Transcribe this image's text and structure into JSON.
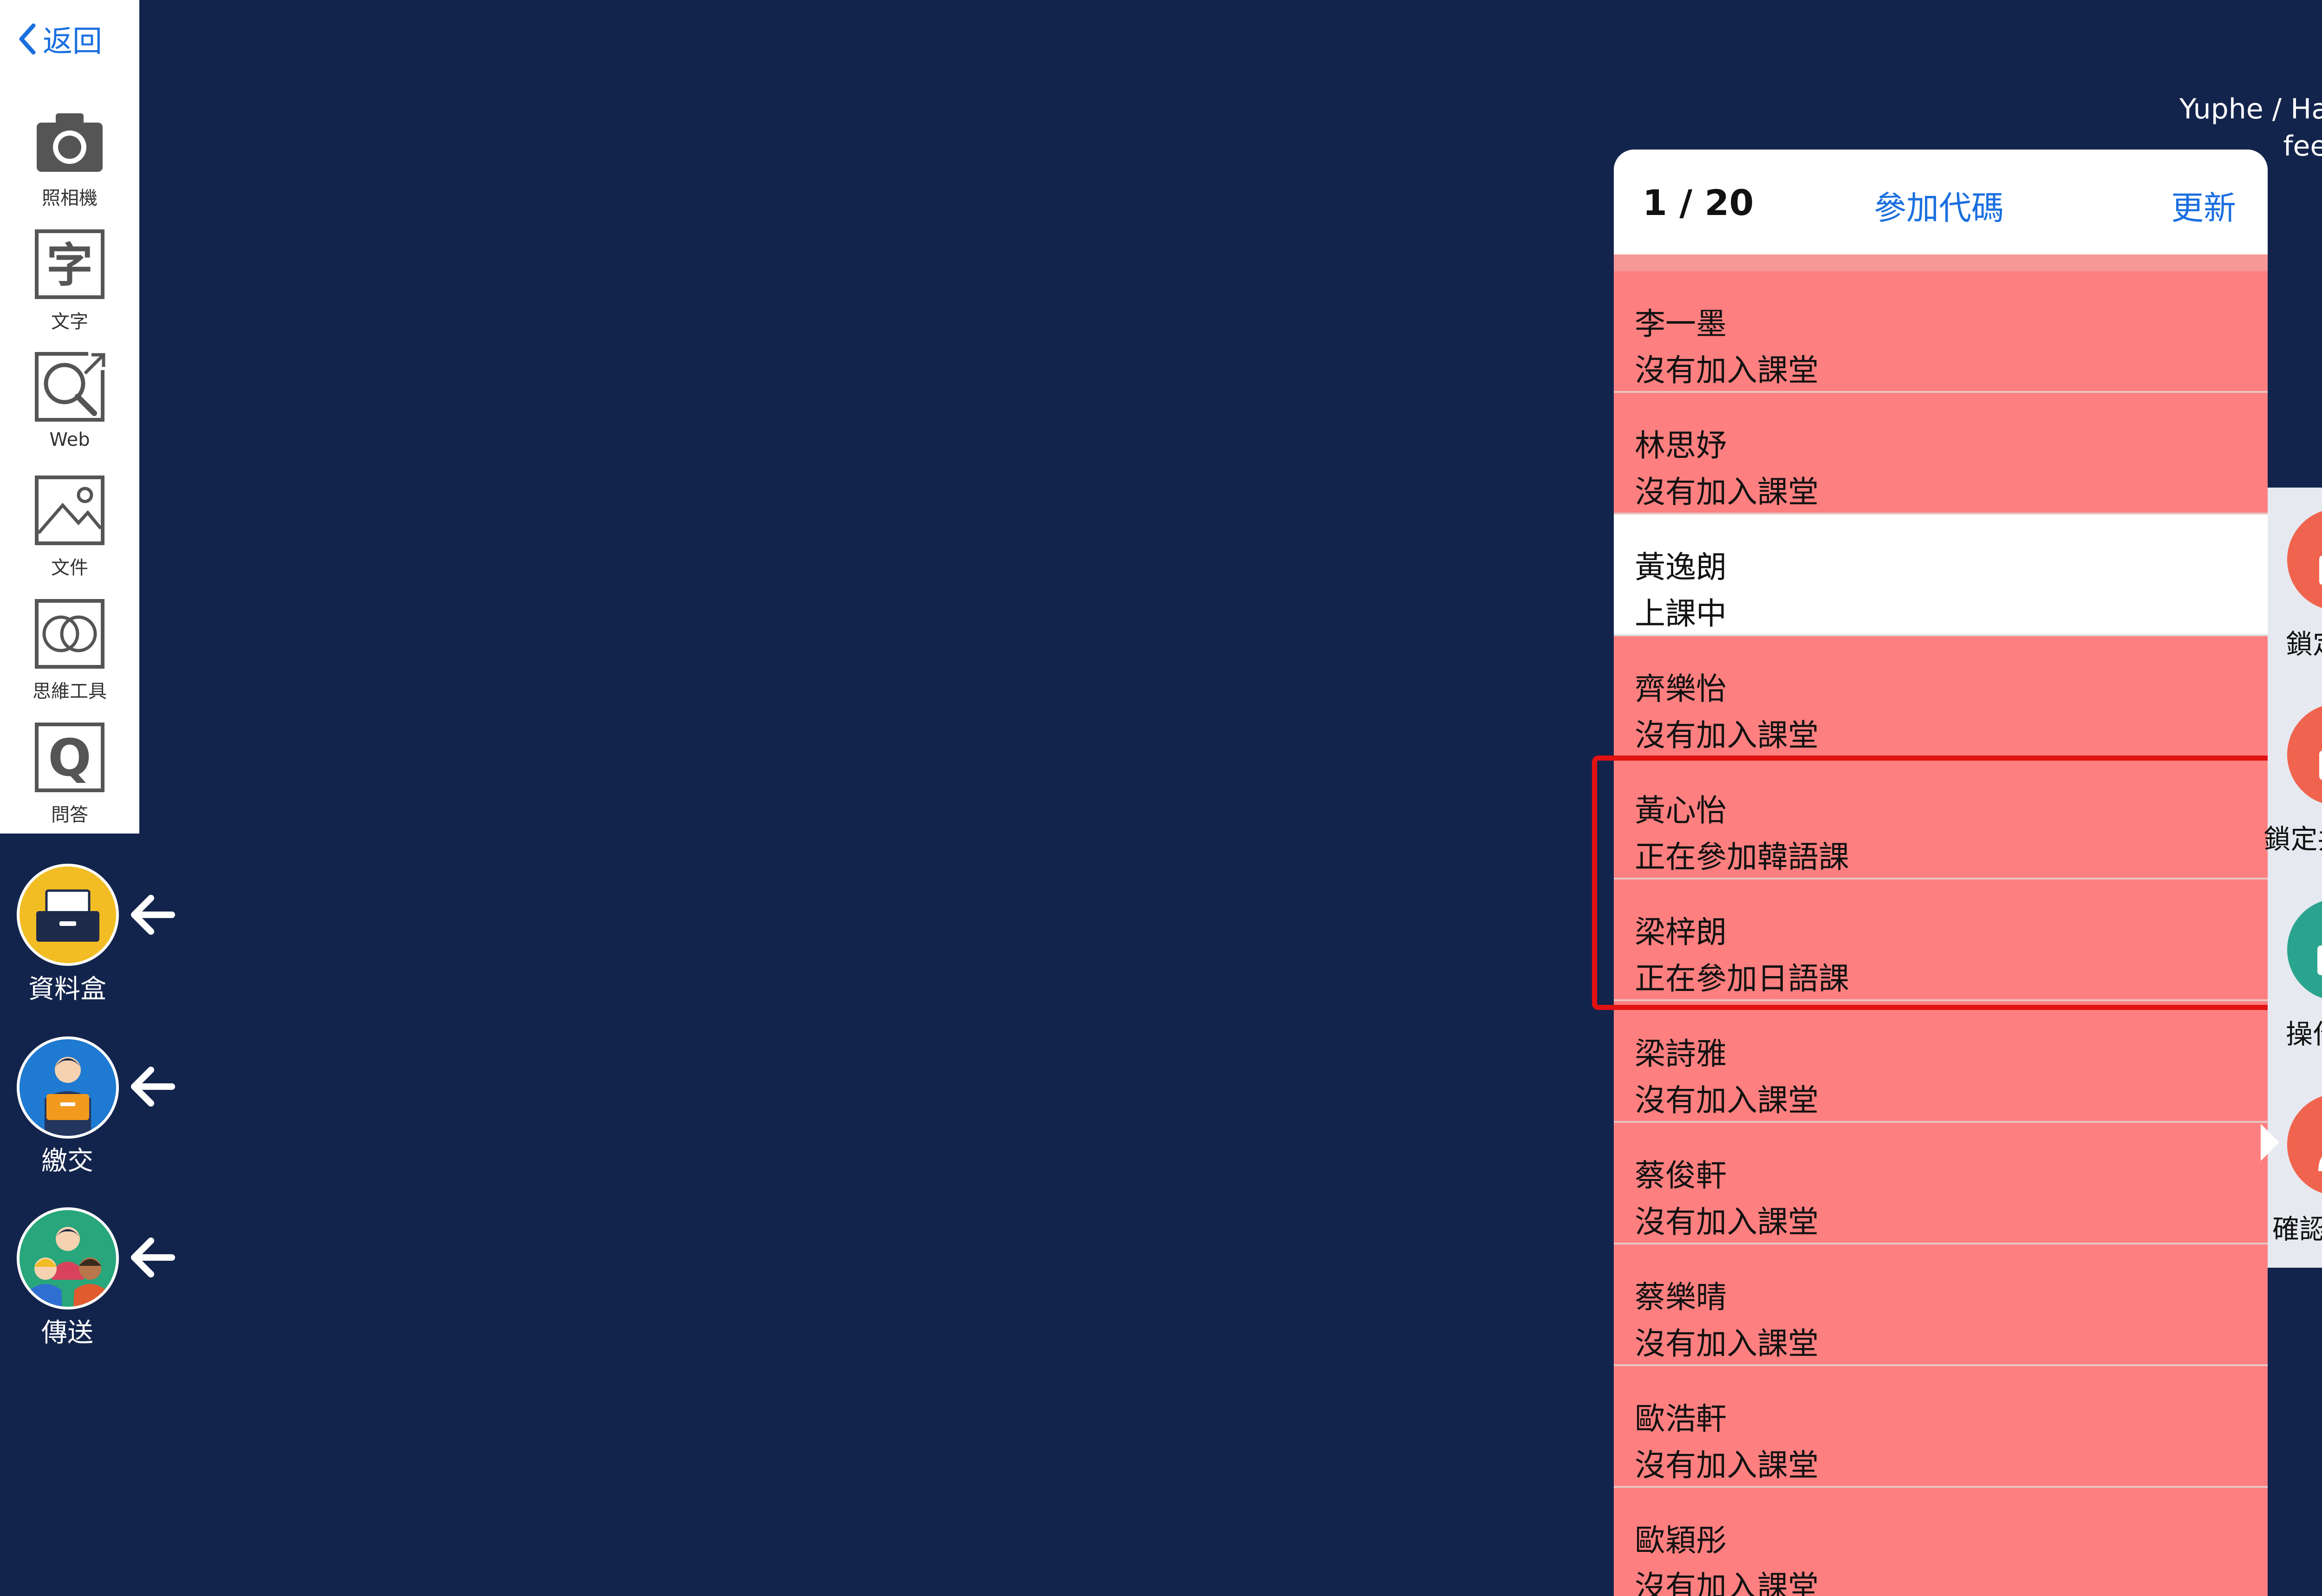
{
  "toolbar": {
    "back_label": "返回",
    "tools": [
      {
        "label": "照相機",
        "icon": "camera-icon"
      },
      {
        "label": "文字",
        "icon": "text-icon"
      },
      {
        "label": "Web",
        "icon": "web-search-icon"
      },
      {
        "label": "文件",
        "icon": "image-icon"
      },
      {
        "label": "思維工具",
        "icon": "thinking-tool-icon"
      },
      {
        "label": "問答",
        "icon": "qa-icon"
      }
    ]
  },
  "side_actions": [
    {
      "label": "資料盒",
      "icon": "data-box-icon"
    },
    {
      "label": "繳交",
      "icon": "submit-icon"
    },
    {
      "label": "傳送",
      "icon": "send-icon"
    }
  ],
  "user": {
    "name_line1": "Yuphe / Hant WS",
    "name_line2": "feedback"
  },
  "panel": {
    "count": "1 / 20",
    "join_code_label": "參加代碼",
    "refresh_label": "更新",
    "participants": [
      {
        "name": "李一墨",
        "status": "沒有加入課堂"
      },
      {
        "name": "林思妤",
        "status": "沒有加入課堂"
      },
      {
        "name": "黃逸朗",
        "status": "上課中"
      },
      {
        "name": "齊樂怡",
        "status": "沒有加入課堂"
      },
      {
        "name": "黃心怡",
        "status": "正在參加韓語課"
      },
      {
        "name": "梁梓朗",
        "status": "正在參加日語課"
      },
      {
        "name": "梁詩雅",
        "status": "沒有加入課堂"
      },
      {
        "name": "蔡俊軒",
        "status": "沒有加入課堂"
      },
      {
        "name": "蔡樂晴",
        "status": "沒有加入課堂"
      },
      {
        "name": "歐浩軒",
        "status": "沒有加入課堂"
      },
      {
        "name": "歐穎彤",
        "status": "沒有加入課堂"
      }
    ]
  },
  "right_actions": [
    {
      "label": "鎖定傳送",
      "icon": "lock-icon"
    },
    {
      "label": "鎖定共享筆記",
      "icon": "lock-icon"
    },
    {
      "label": "操作鎖定",
      "icon": "unlock-icon"
    },
    {
      "label": "確認參加者",
      "icon": "person-icon"
    }
  ],
  "colors": {
    "background": "#13244c",
    "accent": "#1a6fe0",
    "inactive_row": "#fe7f7f",
    "active_row": "#ffffff",
    "lock_button": "#f0644f",
    "unlock_button": "#2aa48f",
    "highlight": "#e21212"
  }
}
